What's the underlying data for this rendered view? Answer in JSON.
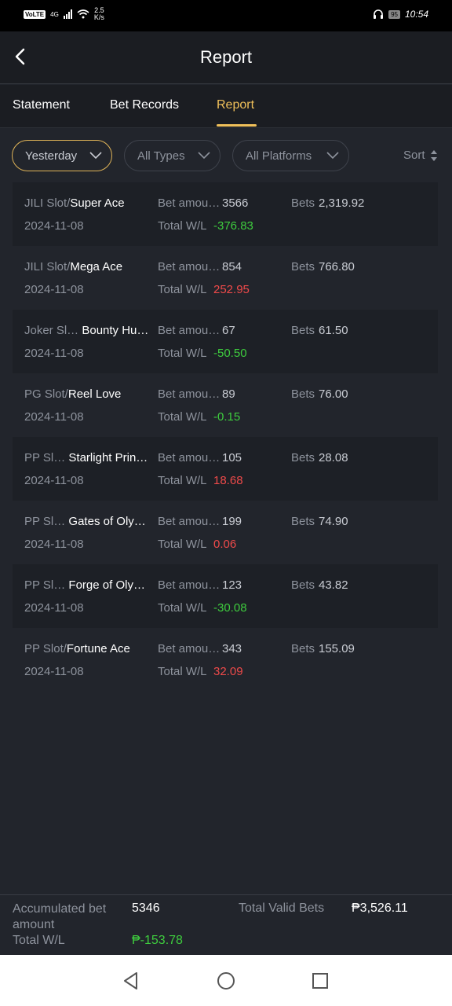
{
  "status": {
    "volte": "VoLTE",
    "net": "4G",
    "speed_top": "2.5",
    "speed_bot": "K/s",
    "battery": "95",
    "time": "10:54"
  },
  "header": {
    "title": "Report"
  },
  "tabs": [
    {
      "label": "Statement",
      "active": false
    },
    {
      "label": "Bet Records",
      "active": false
    },
    {
      "label": "Report",
      "active": true
    }
  ],
  "filters": {
    "date": "Yesterday",
    "type": "All Types",
    "platform": "All Platforms",
    "sort": "Sort"
  },
  "labels": {
    "bet_amount": "Bet amou…",
    "total_wl": "Total W/L",
    "bets": "Bets"
  },
  "records": [
    {
      "platform": "JILI Slot/",
      "game": "Super Ace",
      "date": "2024-11-08",
      "bet_amount": "3566",
      "total_wl": "-376.83",
      "bets": "2,319.92"
    },
    {
      "platform": "JILI Slot/",
      "game": "Mega Ace",
      "date": "2024-11-08",
      "bet_amount": "854",
      "total_wl": "252.95",
      "bets": "766.80"
    },
    {
      "platform": "Joker Sl…",
      "game": "Bounty Hu…",
      "date": "2024-11-08",
      "bet_amount": "67",
      "total_wl": "-50.50",
      "bets": "61.50"
    },
    {
      "platform": "PG Slot/",
      "game": "Reel Love",
      "date": "2024-11-08",
      "bet_amount": "89",
      "total_wl": "-0.15",
      "bets": "76.00"
    },
    {
      "platform": "PP Sl…",
      "game": "Starlight Prin…",
      "date": "2024-11-08",
      "bet_amount": "105",
      "total_wl": "18.68",
      "bets": "28.08"
    },
    {
      "platform": "PP Sl…",
      "game": "Gates of Oly…",
      "date": "2024-11-08",
      "bet_amount": "199",
      "total_wl": "0.06",
      "bets": "74.90"
    },
    {
      "platform": "PP Sl…",
      "game": "Forge of Oly…",
      "date": "2024-11-08",
      "bet_amount": "123",
      "total_wl": "-30.08",
      "bets": "43.82"
    },
    {
      "platform": "PP Slot/",
      "game": "Fortune Ace",
      "date": "2024-11-08",
      "bet_amount": "343",
      "total_wl": "32.09",
      "bets": "155.09"
    }
  ],
  "footer": {
    "acc_label": "Accumulated bet amount",
    "acc_value": "5346",
    "valid_label": "Total Valid Bets",
    "valid_value": "₱3,526.11",
    "wl_label": "Total W/L",
    "wl_value": "₱-153.78"
  },
  "colors": {
    "accent": "#f0c05a",
    "loss": "#3ecc3e",
    "win": "#ef4a4a"
  }
}
